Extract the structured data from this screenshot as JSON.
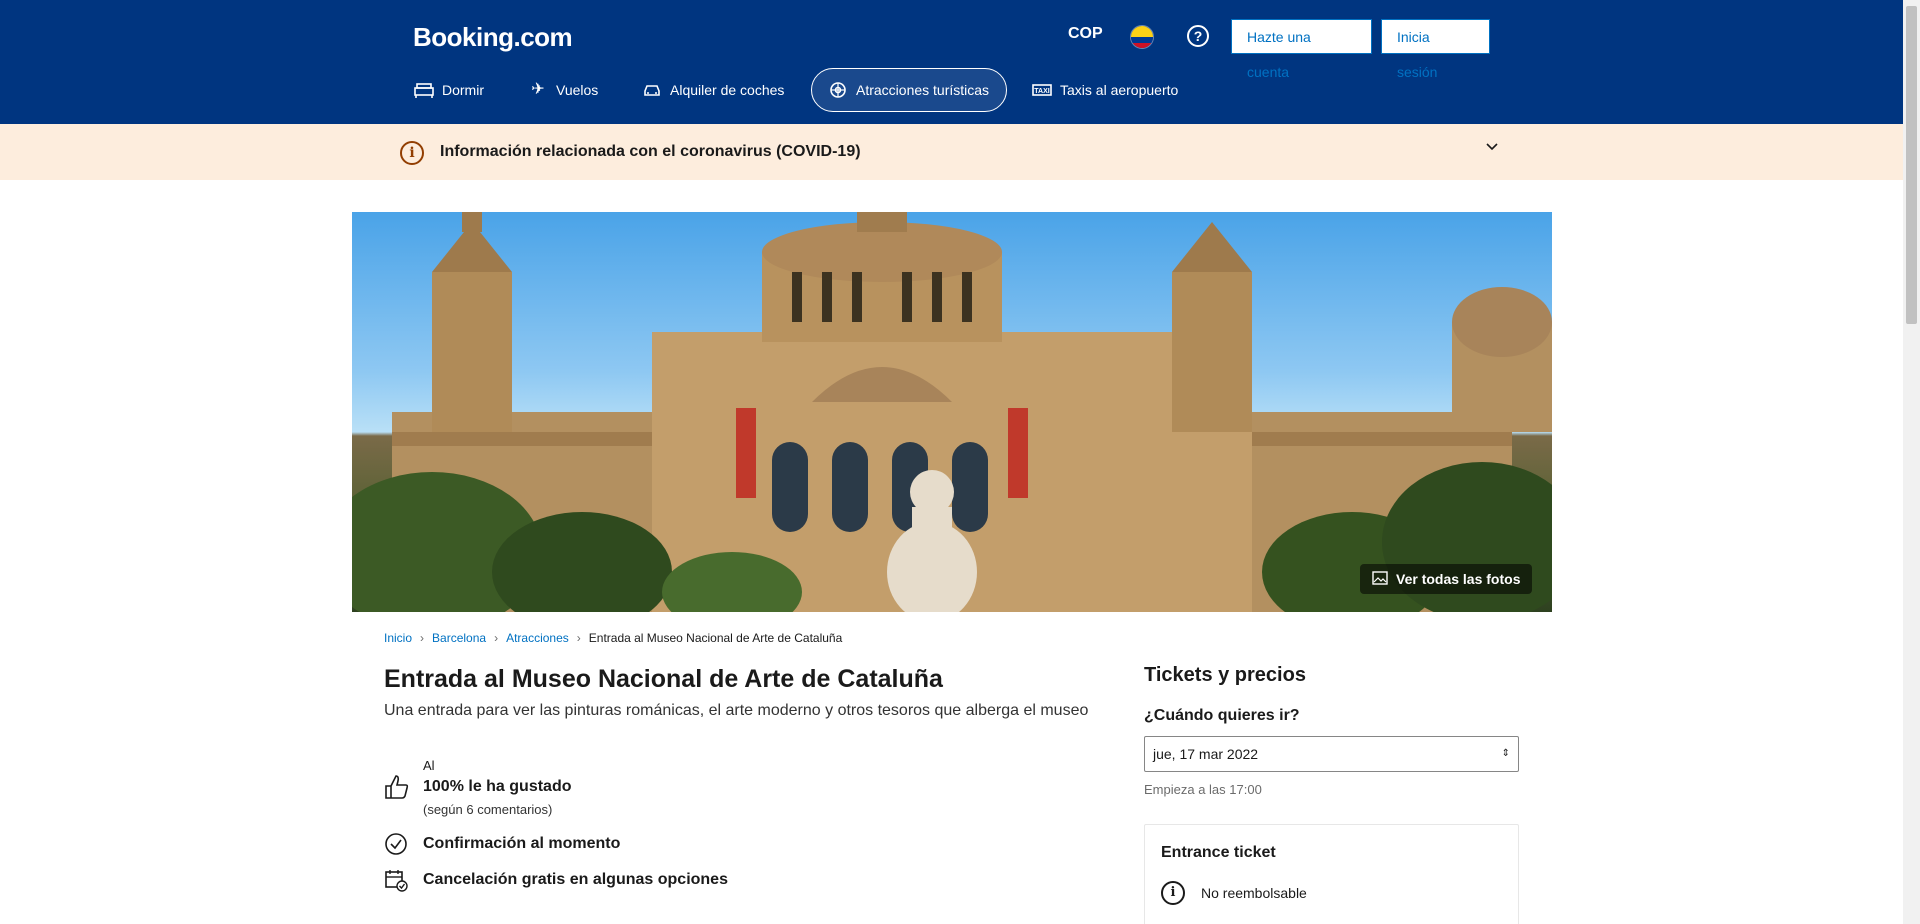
{
  "header": {
    "logo": "Booking.com",
    "currency": "COP",
    "flag_icon": "colombia-flag-icon",
    "help_icon": "question-icon",
    "register_label": "Hazte una cuenta",
    "login_label": "Inicia sesión",
    "background_color": "#003580"
  },
  "nav": [
    {
      "label": "Dormir",
      "icon": "bed-icon"
    },
    {
      "label": "Vuelos",
      "icon": "plane-icon"
    },
    {
      "label": "Alquiler de coches",
      "icon": "car-icon"
    },
    {
      "label": "Atracciones turísticas",
      "icon": "attractions-icon",
      "active": true
    },
    {
      "label": "Taxis al aeropuerto",
      "icon": "taxi-icon"
    }
  ],
  "covid_banner": {
    "text": "Información relacionada con el coronavirus (COVID-19)",
    "icon": "info-icon",
    "background_color": "#fdeddd"
  },
  "hero": {
    "photos_label": "Ver todas las fotos",
    "photos_icon": "image-icon"
  },
  "breadcrumb": [
    "Inicio",
    "Barcelona",
    "Atracciones",
    "Entrada al Museo Nacional de Arte de Cataluña"
  ],
  "main": {
    "title": "Entrada al Museo Nacional de Arte de Cataluña",
    "subtitle": "Una entrada para ver las pinturas románicas, el arte moderno y otros tesoros que alberga el museo",
    "al_label": "Al",
    "rating": "100% le ha gustado",
    "reviews": "(según 6 comentarios)",
    "features": [
      "Confirmación al momento",
      "Cancelación gratis en algunas opciones"
    ]
  },
  "tickets": {
    "title": "Tickets y precios",
    "when_label": "¿Cuándo quieres ir?",
    "date_value": "jue, 17 mar 2022",
    "starts_at": "Empieza a las 17:00",
    "ticket_name": "Entrance ticket",
    "ticket_policy": "No reembolsable"
  },
  "colors": {
    "link": "#0071c2",
    "brand": "#003580"
  }
}
